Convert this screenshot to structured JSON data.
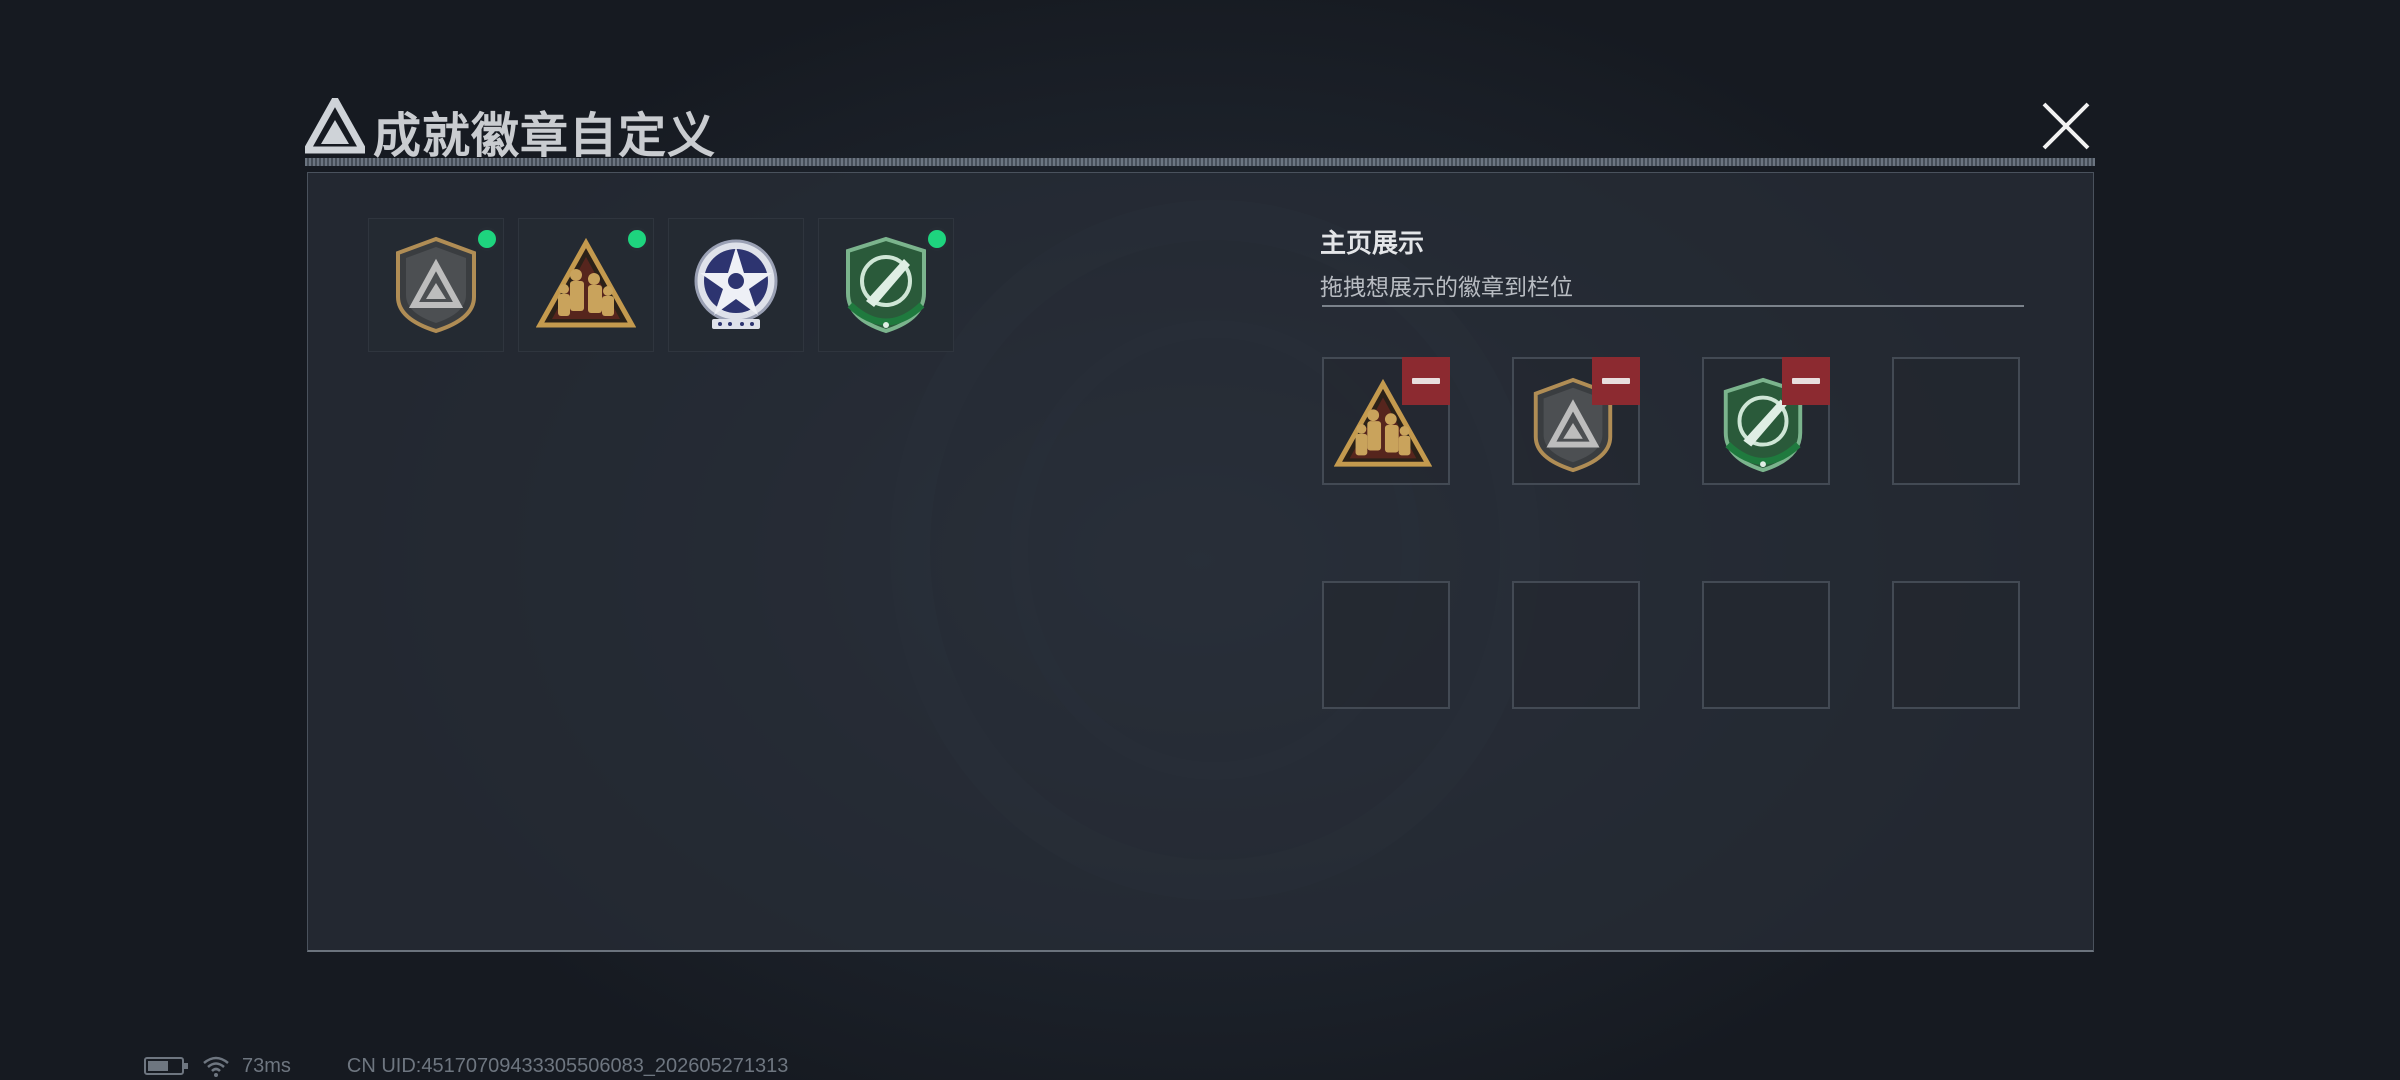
{
  "window": {
    "title": "成就徽章自定义"
  },
  "owned_badges": [
    {
      "icon": "shield-triangle-badge-icon",
      "selected": true
    },
    {
      "icon": "soldiers-triangle-badge-icon",
      "selected": true
    },
    {
      "icon": "star-wings-badge-icon",
      "selected": false
    },
    {
      "icon": "green-knife-shield-badge-icon",
      "selected": true
    }
  ],
  "showcase": {
    "title": "主页展示",
    "subtitle": "拖拽想展示的徽章到栏位",
    "slots": [
      {
        "icon": "soldiers-triangle-badge-icon"
      },
      {
        "icon": "shield-triangle-badge-icon"
      },
      {
        "icon": "green-knife-shield-badge-icon"
      },
      {
        "icon": null
      },
      {
        "icon": null
      },
      {
        "icon": null
      },
      {
        "icon": null
      },
      {
        "icon": null
      }
    ]
  },
  "status": {
    "ping": "73ms",
    "uid": "CN UID:45170709433305506083_202605271313"
  },
  "colors": {
    "selected_dot": "#1ed47e",
    "remove_button": "#8c2a30",
    "background": "#181d25"
  }
}
